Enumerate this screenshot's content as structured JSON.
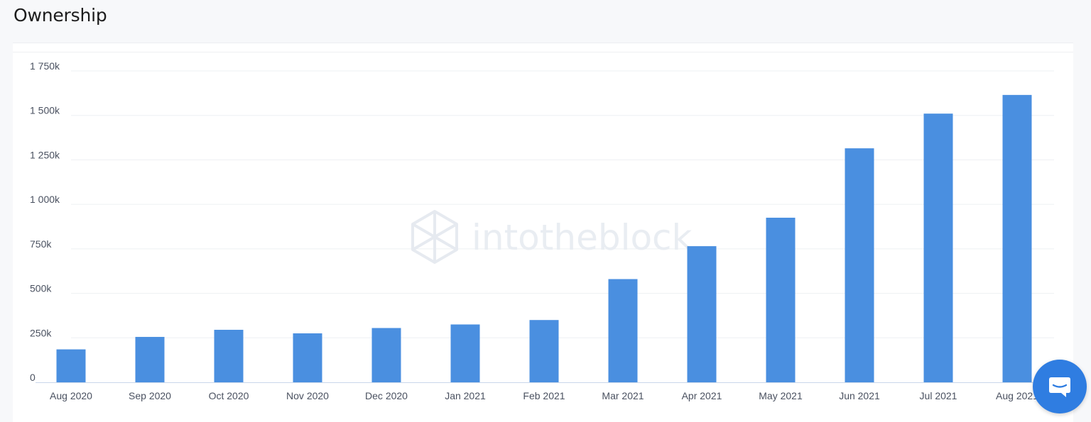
{
  "section": {
    "title": "Ownership"
  },
  "watermark": {
    "brand": "intotheblock",
    "icon": "intotheblock-logo-icon"
  },
  "chat": {
    "icon": "chat-bubble-icon"
  },
  "colors": {
    "bar": "#4a8fe0",
    "grid": "#eef0f3",
    "axis": "#c9d6ea",
    "tick_text": "#4a5160",
    "chat_button": "#2f7de1"
  },
  "chart_data": {
    "type": "bar",
    "title": "",
    "xlabel": "",
    "ylabel": "",
    "categories": [
      "Aug 2020",
      "Sep 2020",
      "Oct 2020",
      "Nov 2020",
      "Dec 2020",
      "Jan 2021",
      "Feb 2021",
      "Mar 2021",
      "Apr 2021",
      "May 2021",
      "Jun 2021",
      "Jul 2021",
      "Aug 2021"
    ],
    "values": [
      185000,
      255000,
      295000,
      275000,
      305000,
      325000,
      350000,
      580000,
      765000,
      925000,
      1315000,
      1510000,
      1615000
    ],
    "ylim": [
      0,
      1750000
    ],
    "yticks": [
      0,
      250000,
      500000,
      750000,
      1000000,
      1250000,
      1500000,
      1750000
    ],
    "ytick_labels": [
      "0",
      "250k",
      "500k",
      "750k",
      "1 000k",
      "1 250k",
      "1 500k",
      "1 750k"
    ],
    "grid": true,
    "legend": "none"
  }
}
